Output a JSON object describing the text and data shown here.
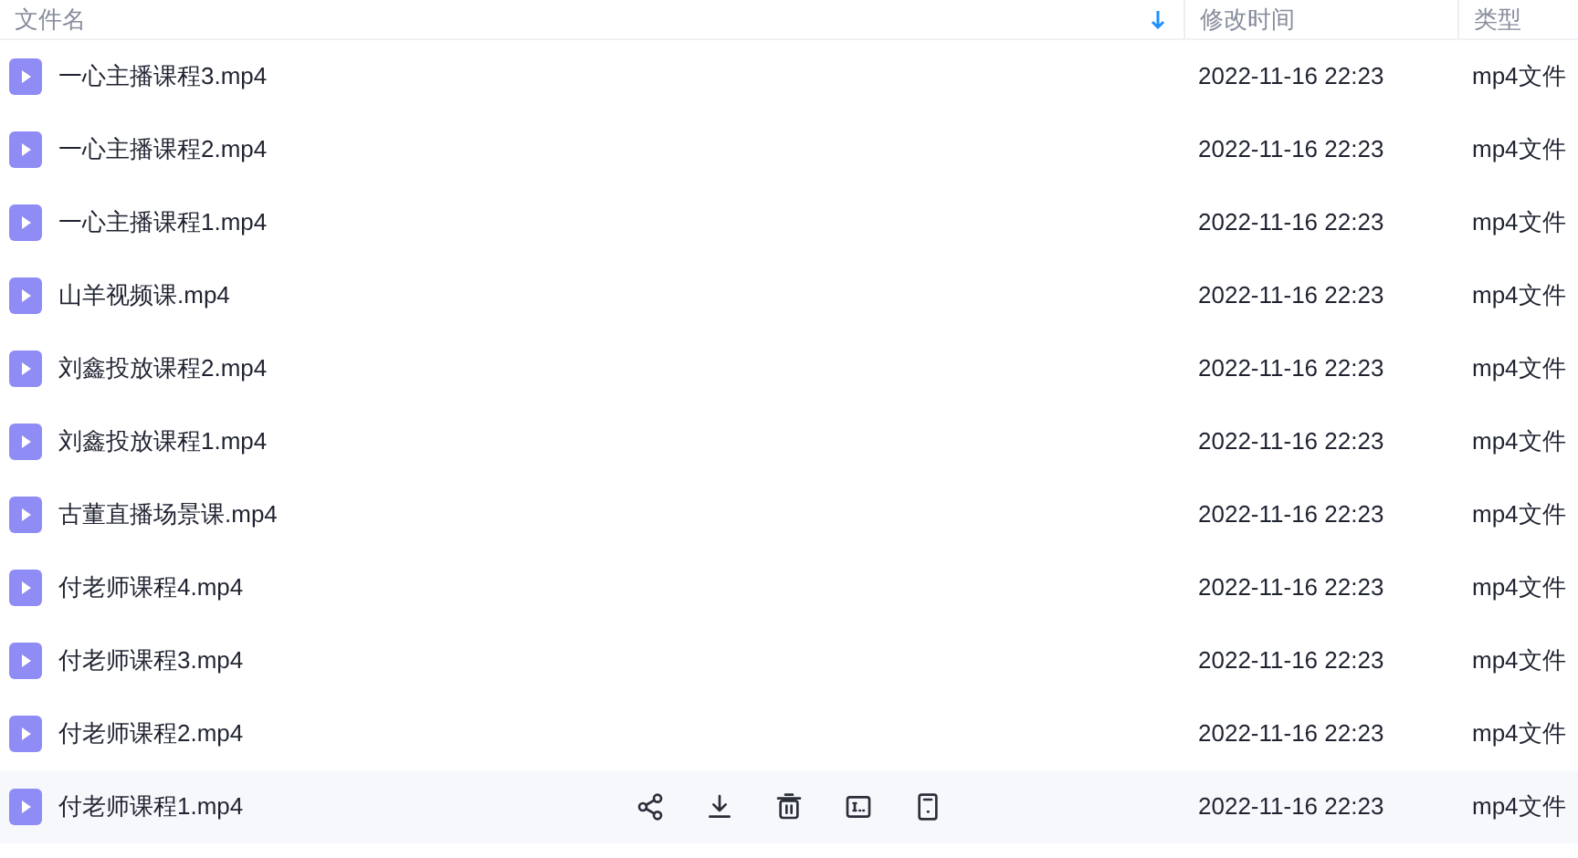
{
  "columns": [
    {
      "label": "文件名",
      "sorted": true
    },
    {
      "label": "修改时间",
      "sorted": false
    },
    {
      "label": "类型",
      "sorted": false
    }
  ],
  "rows": [
    {
      "name": "一心主播课程3.mp4",
      "modified": "2022-11-16 22:23",
      "type": "mp4文件",
      "hovered": false
    },
    {
      "name": "一心主播课程2.mp4",
      "modified": "2022-11-16 22:23",
      "type": "mp4文件",
      "hovered": false
    },
    {
      "name": "一心主播课程1.mp4",
      "modified": "2022-11-16 22:23",
      "type": "mp4文件",
      "hovered": false
    },
    {
      "name": "山羊视频课.mp4",
      "modified": "2022-11-16 22:23",
      "type": "mp4文件",
      "hovered": false
    },
    {
      "name": "刘鑫投放课程2.mp4",
      "modified": "2022-11-16 22:23",
      "type": "mp4文件",
      "hovered": false
    },
    {
      "name": "刘鑫投放课程1.mp4",
      "modified": "2022-11-16 22:23",
      "type": "mp4文件",
      "hovered": false
    },
    {
      "name": "古董直播场景课.mp4",
      "modified": "2022-11-16 22:23",
      "type": "mp4文件",
      "hovered": false
    },
    {
      "name": "付老师课程4.mp4",
      "modified": "2022-11-16 22:23",
      "type": "mp4文件",
      "hovered": false
    },
    {
      "name": "付老师课程3.mp4",
      "modified": "2022-11-16 22:23",
      "type": "mp4文件",
      "hovered": false
    },
    {
      "name": "付老师课程2.mp4",
      "modified": "2022-11-16 22:23",
      "type": "mp4文件",
      "hovered": false
    },
    {
      "name": "付老师课程1.mp4",
      "modified": "2022-11-16 22:23",
      "type": "mp4文件",
      "hovered": true
    }
  ]
}
